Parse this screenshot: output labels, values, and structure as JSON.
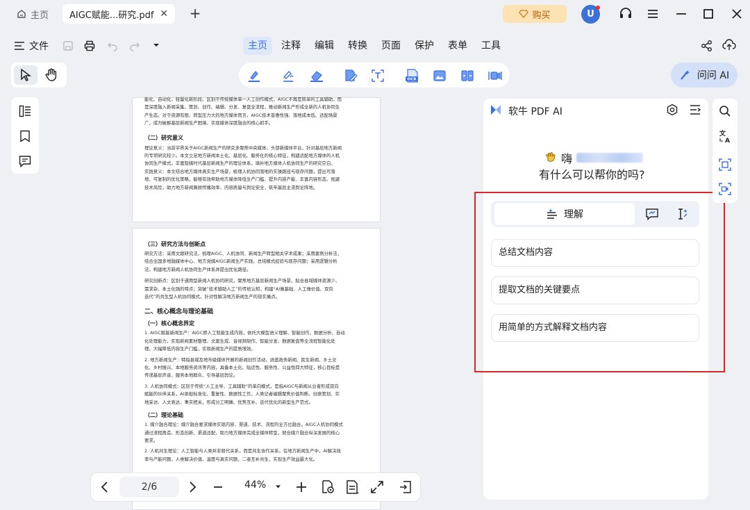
{
  "titlebar": {
    "home_label": "主页",
    "doc_tab_label": "AIGC赋能...研究.pdf",
    "buy_label": "购买",
    "avatar_letter": "U"
  },
  "menu": {
    "file_label": "文件",
    "tabs": [
      "主页",
      "注释",
      "编辑",
      "转换",
      "页面",
      "保护",
      "表单",
      "工具"
    ],
    "active_tab": "主页"
  },
  "ask_ai_label": "问问 AI",
  "pdf": {
    "page1": {
      "lines_top": [
        "能化、自动化、轻量化新阶段。区别于传统媒体单一人工创作模式，AIGC不再是简单的工具辅助，而",
        "是深度融入新闻采集、策划、创作、编辑、分发、复盘全流程，推动新闻生产形成全新的人机协同生",
        "产生态。对于资源有限、转型压力大的地方媒体而言，AIGC技术普惠性强、落地成本低、适配场景",
        "广，成为破解基层新闻生产困境、实现媒体深度融合的核心抓手。"
      ],
      "section_heading": "（二）研究意义",
      "lines_bottom": [
        "理论意义：当前学界关于AIGC新闻生产的研究多聚焦中央媒体、头部新媒体平台，针对基层地方新闻",
        "的专项研究较少。本文立足地方新闻本土化、基层化、服务化的核心特征，构建适配地方媒体的人机",
        "协同生产模式，丰富智媒时代基层新闻生产的理论体系，填补地方媒体人机协同生产的研究空白。",
        "实践意义：本文结合地方媒体真实生产场景，梳理人机协同落地的实操路径与现存问题，提出可落",
        "地、可复制的优化策略，能够有效帮助地方媒体降低生产门槛、提升内容产能、丰富内容形态、规避",
        "技术风险，助力地方新闻兼顾传播效率、内容质量与舆论安全，筑牢基层主流舆论阵地。"
      ]
    },
    "page2": {
      "heading1": "（三）研究方法与创新点",
      "lines1": [
        "研究方法：采用文献研究法，梳理AIGC、人机协同、新闻生产转型相关学术成果；采用案例分析法，",
        "结合全国多地融媒体中心、地方党媒AIGC新闻生产实践，总结模式经验与现存问题；采用逻辑分析",
        "法，构建地方新闻人机协同生产体系并提出优化路径。",
        "研究创新点：区别于通用型新闻人机协同研究，聚焦地方基层新闻生产场景，贴合县域媒体资源少、",
        "需求杂、本土化强的特点；突破“技术辅助人工”的传统认知，构建“AI做基础、人工做价值、双向",
        "迭代”的共生型人机协同模式，针对性解决地方新闻生产的现实痛点。"
      ],
      "heading2": "二、核心概念与理论基础",
      "heading3": "（一）核心概念界定",
      "lines2": [
        "1. AIGC赋能新闻生产：AIGC即人工智能生成内容，依托大模型语义理解、智能创作、数据分析、自动",
        "化处理能力，实现新闻素材整理、文案生成、音视频制作、智能分发、数据复盘等全流程智能化处",
        "理，大幅降低内容生产门槛，实现新闻生产的提质增效。",
        "2. 地方新闻生产：特指县域及地市级媒体开展的新闻创作活动，涵盖政务新闻、民生新闻、乡土文",
        "化、乡村振兴、本地服务资讯等内容，具备本土化、贴近性、服务性、公益性四大特征，核心目标是",
        "传递基层声音、服务本地群众、引导基层舆论。",
        "3. 人机协同模式：区别于传统“人工主导、工具辅助”的单向模式，是指AIGC与新闻从业者形成双向",
        "赋能的伙伴关系，AI承担标准化、重复性、数据性工作，人类记者编辑聚焦价值判断、创意策划、实",
        "地采访、人文表达、事实把关，形成分工明确、优势互补、迭代优化的新型生产范式。"
      ],
      "heading4": "（二）理论基础",
      "lines3": [
        "1. 媒介融合理论：媒介融合要求媒体实现内容、渠道、技术、流程的全方位融合，AIGC人机协同模式",
        "通过流程再造、形态创新、渠道适配，助力地方媒体完成全媒体转型，契合媒介融合纵深发展的核心",
        "要求。",
        "2. 人机共生理论：人工智能与人类并非替代关系，而是共生协作关系。在地方新闻生产中，AI解决效",
        "率与产能问题，人类解决价值、温度与真实问题，二者互补共生，实现生产效益最大化。"
      ]
    }
  },
  "bottom_bar": {
    "page_indicator": "2/6",
    "zoom": "44%"
  },
  "ai": {
    "title": "软牛 PDF AI",
    "greeting": "嗨",
    "question": "有什么可以帮你的吗?",
    "mode_label": "理解",
    "suggestions": [
      "总结文档内容",
      "提取文档的关键要点",
      "用简单的方式解释文档内容"
    ]
  },
  "colors": {
    "accent": "#3770e6",
    "highlight_border": "#d9262a",
    "buy_bg": "#fde3b4",
    "ask_ai_bg": "#d4dff8"
  }
}
